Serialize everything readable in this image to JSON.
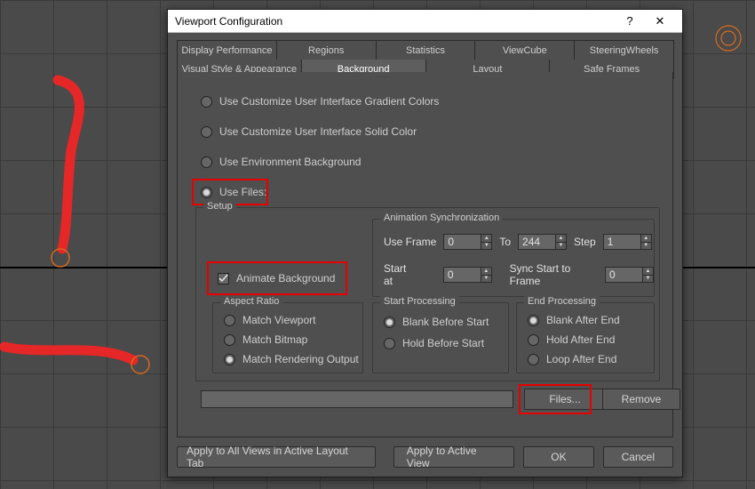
{
  "dialog": {
    "title": "Viewport Configuration",
    "help_char": "?",
    "close_char": "✕",
    "tabs_row1": [
      "Display Performance",
      "Regions",
      "Statistics",
      "ViewCube",
      "SteeringWheels"
    ],
    "tabs_row2": [
      "Visual Style & Appearance",
      "Background",
      "Layout",
      "Safe Frames"
    ],
    "tabs_row2_selected": 1
  },
  "bg_source": {
    "gradient": "Use Customize User Interface Gradient Colors",
    "solid": "Use Customize User Interface Solid Color",
    "env": "Use Environment Background",
    "files": "Use Files:",
    "selected": "files"
  },
  "setup": {
    "legend": "Setup",
    "animate_label": "Animate Background",
    "animate_checked": true
  },
  "aspect": {
    "legend": "Aspect Ratio",
    "opt_viewport": "Match Viewport",
    "opt_bitmap": "Match Bitmap",
    "opt_render": "Match Rendering Output",
    "selected": "render"
  },
  "anim_sync": {
    "legend": "Animation Synchronization",
    "use_frame_label": "Use Frame",
    "use_frame_from": "0",
    "to_label": "To",
    "use_frame_to": "244",
    "step_label": "Step",
    "step": "1",
    "start_at_label": "Start at",
    "start_at": "0",
    "sync_label": "Sync Start to Frame",
    "sync_value": "0"
  },
  "start_proc": {
    "legend": "Start Processing",
    "blank": "Blank Before Start",
    "hold": "Hold Before Start",
    "selected": "blank"
  },
  "end_proc": {
    "legend": "End Processing",
    "blank": "Blank After End",
    "hold": "Hold After End",
    "loop": "Loop After End",
    "selected": "blank"
  },
  "file": {
    "path": "",
    "files_btn": "Files...",
    "remove_btn": "Remove"
  },
  "footer": {
    "apply_all": "Apply to All Views in Active Layout Tab",
    "apply_active": "Apply to Active View",
    "ok": "OK",
    "cancel": "Cancel"
  }
}
